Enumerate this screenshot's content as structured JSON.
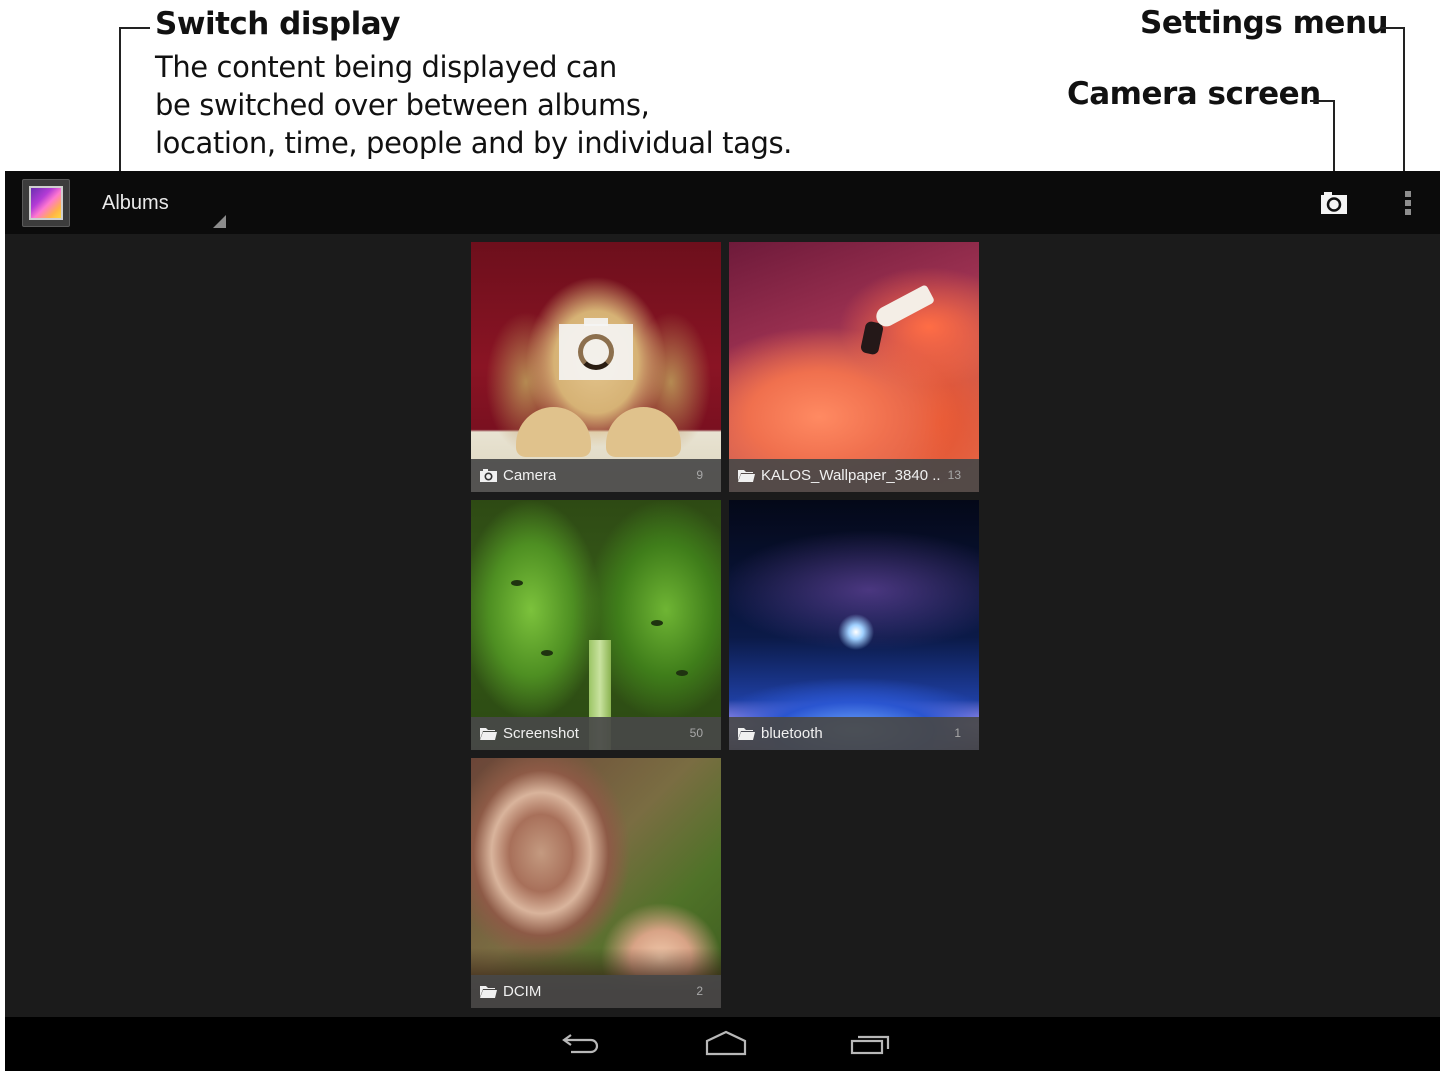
{
  "annotations": {
    "switch_display": {
      "title": "Switch display",
      "description_lines": [
        "The content being displayed can",
        "be switched over between albums,",
        "location, time, people and by individual tags."
      ]
    },
    "settings_menu": {
      "title": "Settings menu"
    },
    "camera_screen": {
      "title": "Camera screen"
    }
  },
  "action_bar": {
    "app_icon": "gallery-app-icon",
    "view_spinner": {
      "selected": "Albums"
    },
    "actions": [
      {
        "name": "camera",
        "icon": "camera-icon"
      },
      {
        "name": "overflow-menu",
        "icon": "overflow-menu-icon"
      }
    ]
  },
  "albums": [
    {
      "name": "Camera",
      "count": "9",
      "icon": "camera-icon",
      "thumbnail": "puppy"
    },
    {
      "name": "KALOS_Wallpaper_3840 ...",
      "count": "13",
      "icon": "folder-icon",
      "thumbnail": "flamingo"
    },
    {
      "name": "Screenshot",
      "count": "50",
      "icon": "folder-icon",
      "thumbnail": "leaf"
    },
    {
      "name": "bluetooth",
      "count": "1",
      "icon": "folder-icon",
      "thumbnail": "space"
    },
    {
      "name": "DCIM",
      "count": "2",
      "icon": "folder-icon",
      "thumbnail": "shell"
    }
  ],
  "nav_bar": {
    "buttons": [
      {
        "name": "back",
        "icon": "back-icon"
      },
      {
        "name": "home",
        "icon": "home-icon"
      },
      {
        "name": "recent-apps",
        "icon": "recent-apps-icon"
      }
    ]
  },
  "colors": {
    "action_bar_bg": "#0b0b0b",
    "content_bg": "#1b1b1b",
    "nav_bar_bg": "#000000",
    "label_bar_bg": "#484848",
    "label_text": "#f0f0f0",
    "count_text": "#a8a8a8"
  }
}
